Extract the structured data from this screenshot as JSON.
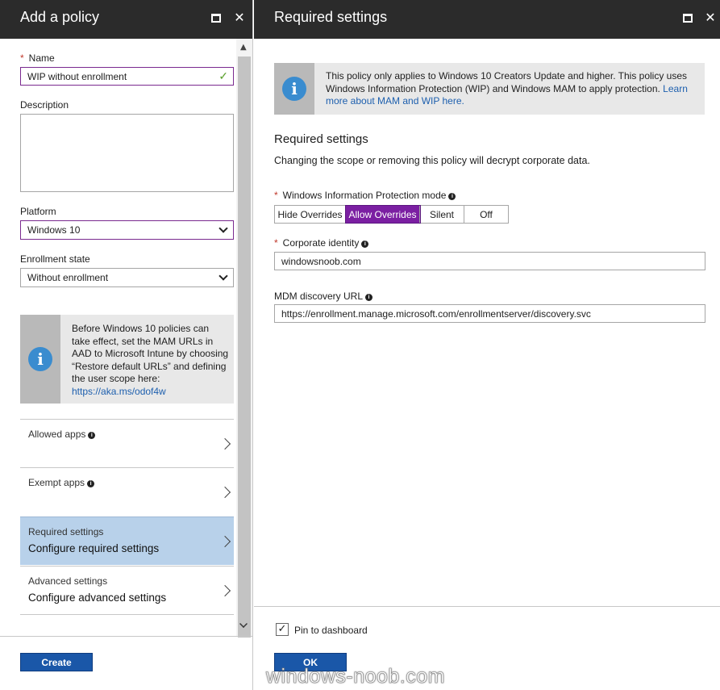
{
  "left": {
    "title": "Add a policy",
    "name_label": "Name",
    "name_value": "WIP without enrollment",
    "description_label": "Description",
    "platform_label": "Platform",
    "platform_value": "Windows 10",
    "enrollment_label": "Enrollment state",
    "enrollment_value": "Without enrollment",
    "info_text": "Before Windows 10 policies can take effect, set the MAM URLs in AAD to Microsoft Intune by choosing “Restore default URLs” and defining the user scope here:",
    "info_link": "https://aka.ms/odof4w",
    "nav": [
      {
        "label": "Allowed apps",
        "sub": ""
      },
      {
        "label": "Exempt apps",
        "sub": ""
      },
      {
        "label": "Required settings",
        "sub": "Configure required settings"
      },
      {
        "label": "Advanced settings",
        "sub": "Configure advanced settings"
      }
    ],
    "create_label": "Create"
  },
  "right": {
    "title": "Required settings",
    "info_text": "This policy only applies to Windows 10 Creators Update and higher. This policy uses Windows Information Protection (WIP) and Windows MAM to apply protection.",
    "info_link": "Learn more about MAM and WIP here.",
    "section_title": "Required settings",
    "section_desc": "Changing the scope or removing this policy will decrypt corporate data.",
    "wip_mode_label": "Windows Information Protection mode",
    "wip_modes": [
      "Hide Overrides",
      "Allow Overrides",
      "Silent",
      "Off"
    ],
    "wip_mode_selected": "Allow Overrides",
    "corp_identity_label": "Corporate identity",
    "corp_identity_value": "windowsnoob.com",
    "mdm_url_label": "MDM discovery URL",
    "mdm_url_value": "https://enrollment.manage.microsoft.com/enrollmentserver/discovery.svc",
    "pin_label": "Pin to dashboard",
    "pin_checked": true,
    "ok_label": "OK"
  },
  "watermark": "windows-noob.com",
  "colors": {
    "header": "#2b2b2b",
    "accent_purple": "#7b1fa2",
    "button_blue": "#1a57a8",
    "selected_nav": "#b8d1ea"
  }
}
